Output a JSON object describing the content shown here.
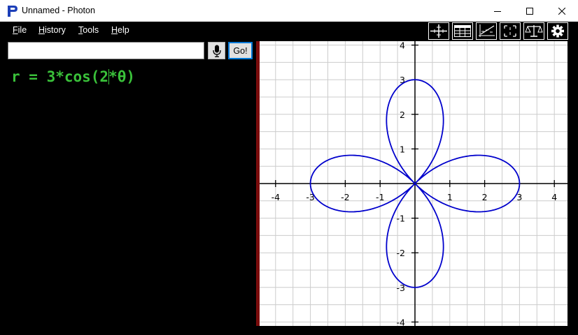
{
  "window": {
    "title": "Unnamed - Photon"
  },
  "menu": {
    "items": [
      {
        "label": "File",
        "accel": "F",
        "rest": "ile"
      },
      {
        "label": "History",
        "accel": "H",
        "rest": "istory"
      },
      {
        "label": "Tools",
        "accel": "T",
        "rest": "ools"
      },
      {
        "label": "Help",
        "accel": "H",
        "rest": "elp"
      }
    ]
  },
  "toolbar": {
    "icons": [
      "axes-icon",
      "table-icon",
      "graph-settings-icon",
      "zoom-fit-icon",
      "scale-icon",
      "gear-icon"
    ]
  },
  "input": {
    "value": "",
    "go_label": "Go!"
  },
  "equation": {
    "before_caret": "r = 3*cos(2",
    "after_caret": "*θ)"
  },
  "colors": {
    "curve": "#0000cc",
    "equation": "#3ac13a",
    "splitter": "#7a0c0c",
    "grid": "#cccccc"
  },
  "chart_data": {
    "type": "line",
    "kind": "polar",
    "expression": "r = 3*cos(2*θ)",
    "amplitude": 3,
    "frequency": 2,
    "xlim": [
      -4.4,
      4.4
    ],
    "ylim": [
      -4,
      4
    ],
    "x_ticks": [
      -4,
      -3,
      -2,
      -1,
      1,
      2,
      3,
      4
    ],
    "y_ticks": [
      -4,
      -3,
      -2,
      -1,
      1,
      2,
      3,
      4
    ],
    "grid_step": 0.5,
    "grid": true
  }
}
